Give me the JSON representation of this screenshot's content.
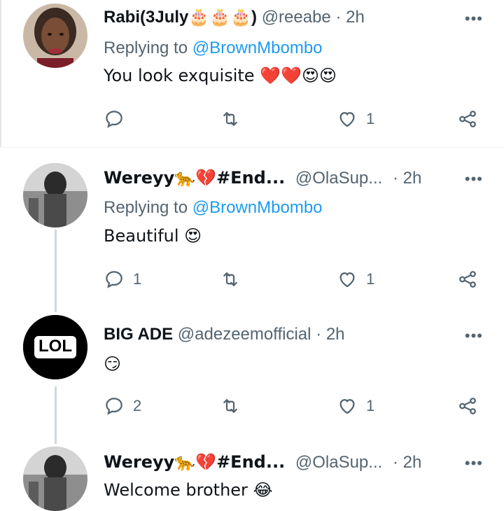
{
  "tweets": [
    {
      "name": "Rabi(3July🎂🎂🎂)",
      "handle": "@reeabe",
      "time": "· 2h",
      "replying_prefix": "Replying to",
      "replying_to": "@BrownMbombo",
      "text": "You look exquisite ❤️❤️😍😍",
      "replies": "",
      "retweets": "",
      "likes": "1"
    },
    {
      "name": "Wereyy🐆💔#End...",
      "handle": "@OlaSup...",
      "time": "· 2h",
      "replying_prefix": "Replying to",
      "replying_to": "@BrownMbombo",
      "text": "Beautiful 😍",
      "replies": "1",
      "retweets": "",
      "likes": "1"
    },
    {
      "name": "BIG ADE",
      "handle": "@adezeemofficial",
      "time": "· 2h",
      "avatar_text": "LOL",
      "text": "😏",
      "replies": "2",
      "retweets": "",
      "likes": "1"
    },
    {
      "name": "Wereyy🐆💔#End...",
      "handle": "@OlaSup...",
      "time": "· 2h",
      "text": "Welcome brother 😂"
    }
  ],
  "more_label": "•••",
  "colors": {
    "accent": "#1d9bf0",
    "muted": "#536471",
    "line": "#cfd9de"
  }
}
